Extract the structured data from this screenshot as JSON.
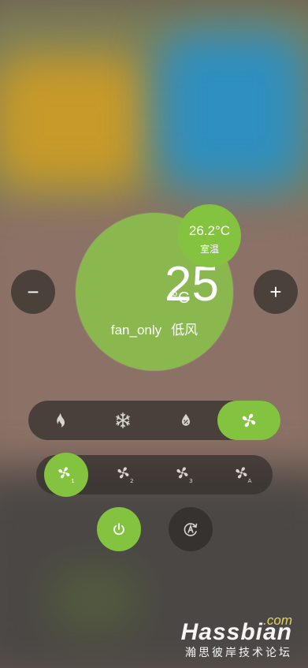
{
  "thermostat": {
    "target_temp": "25",
    "unit": "°C",
    "hvac_mode": "fan_only",
    "fan_speed": "低风",
    "current_temp": "26.2°C",
    "current_label": "室温"
  },
  "controls": {
    "decrease_label": "−",
    "increase_label": "+"
  },
  "modes": [
    {
      "name": "heat",
      "icon": "flame-icon",
      "active": false
    },
    {
      "name": "cool",
      "icon": "snowflake-icon",
      "active": false
    },
    {
      "name": "dry",
      "icon": "water-drop-icon",
      "active": false
    },
    {
      "name": "fan_only",
      "icon": "fan-icon",
      "active": true
    }
  ],
  "fan_speeds": [
    {
      "name": "speed-1",
      "icon": "fan-speed-1-icon",
      "marker": "1",
      "active": true
    },
    {
      "name": "speed-2",
      "icon": "fan-speed-2-icon",
      "marker": "2",
      "active": false
    },
    {
      "name": "speed-3",
      "icon": "fan-speed-3-icon",
      "marker": "3",
      "active": false
    },
    {
      "name": "speed-auto",
      "icon": "fan-speed-auto-icon",
      "marker": "A",
      "active": false
    }
  ],
  "watermark": {
    "com": ".com",
    "brand": "Hassbian",
    "subtitle": "瀚思彼岸技术论坛"
  },
  "colors": {
    "accent": "#84c340",
    "main_circle": "#8bb84e",
    "bar": "#37322f"
  }
}
